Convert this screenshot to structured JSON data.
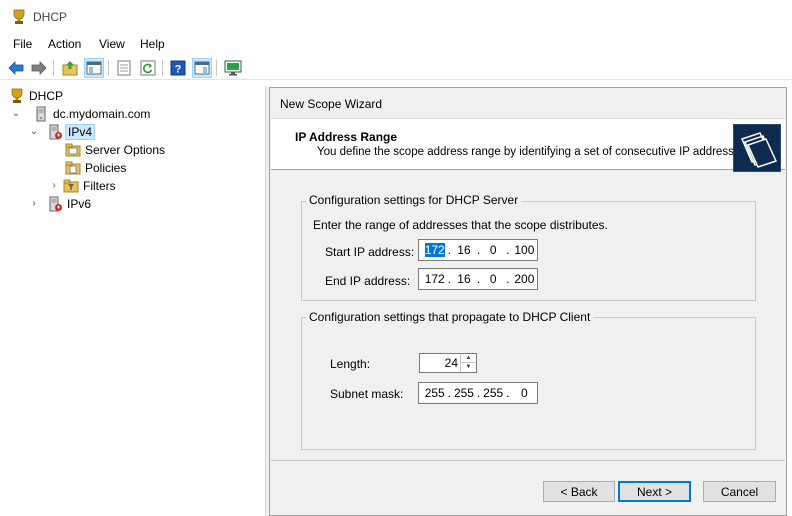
{
  "window": {
    "title": "DHCP"
  },
  "menu": {
    "items": [
      "File",
      "Action",
      "View",
      "Help"
    ]
  },
  "toolbar": {
    "buttons": [
      "back-icon",
      "forward-icon",
      "up-folder-icon",
      "show-hide-tree-icon",
      "properties-icon",
      "refresh-icon",
      "help-icon",
      "view-icon",
      "monitor-icon"
    ]
  },
  "tree": {
    "root": "DHCP",
    "server": "dc.mydomain.com",
    "ipv4": "IPv4",
    "server_options": "Server Options",
    "policies": "Policies",
    "filters": "Filters",
    "ipv6": "IPv6"
  },
  "wizard": {
    "title": "New Scope Wizard",
    "heading": "IP Address Range",
    "subheading": "You define the scope address range by identifying a set of consecutive IP addresses.",
    "server_group": {
      "legend": "Configuration settings for DHCP Server",
      "instruction": "Enter the range of addresses that the scope distributes.",
      "start_label": "Start IP address:",
      "start_ip": [
        "172",
        "16",
        "0",
        "100"
      ],
      "end_label": "End IP address:",
      "end_ip": [
        "172",
        "16",
        "0",
        "200"
      ]
    },
    "client_group": {
      "legend": "Configuration settings that propagate to DHCP Client",
      "length_label": "Length:",
      "length_value": "24",
      "mask_label": "Subnet mask:",
      "subnet_mask": [
        "255",
        "255",
        "255",
        "0"
      ]
    },
    "buttons": {
      "back": "< Back",
      "next": "Next >",
      "cancel": "Cancel"
    }
  },
  "colors": {
    "selection": "#0078d7",
    "wizard_bg": "#f0f0f0",
    "tree_selected": "#cce8ff"
  }
}
